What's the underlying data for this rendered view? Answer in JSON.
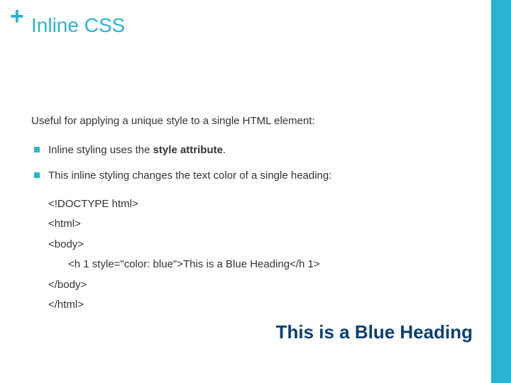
{
  "header": {
    "plus": "+",
    "title": "Inline CSS"
  },
  "intro": "Useful for applying a unique style to a single HTML element:",
  "bullets": {
    "b1_prefix": "Inline styling uses the ",
    "b1_bold": "style attribute",
    "b1_suffix": ".",
    "b2": "This inline styling changes the text color of a single heading:"
  },
  "code": {
    "l1": "<!DOCTYPE html>",
    "l2": "<html>",
    "l3": "<body>",
    "l4": "<h 1 style=\"color: blue\">This is a Blue Heading</h 1>",
    "l5": "</body>",
    "l6": "</html>"
  },
  "result": "This is a Blue Heading"
}
